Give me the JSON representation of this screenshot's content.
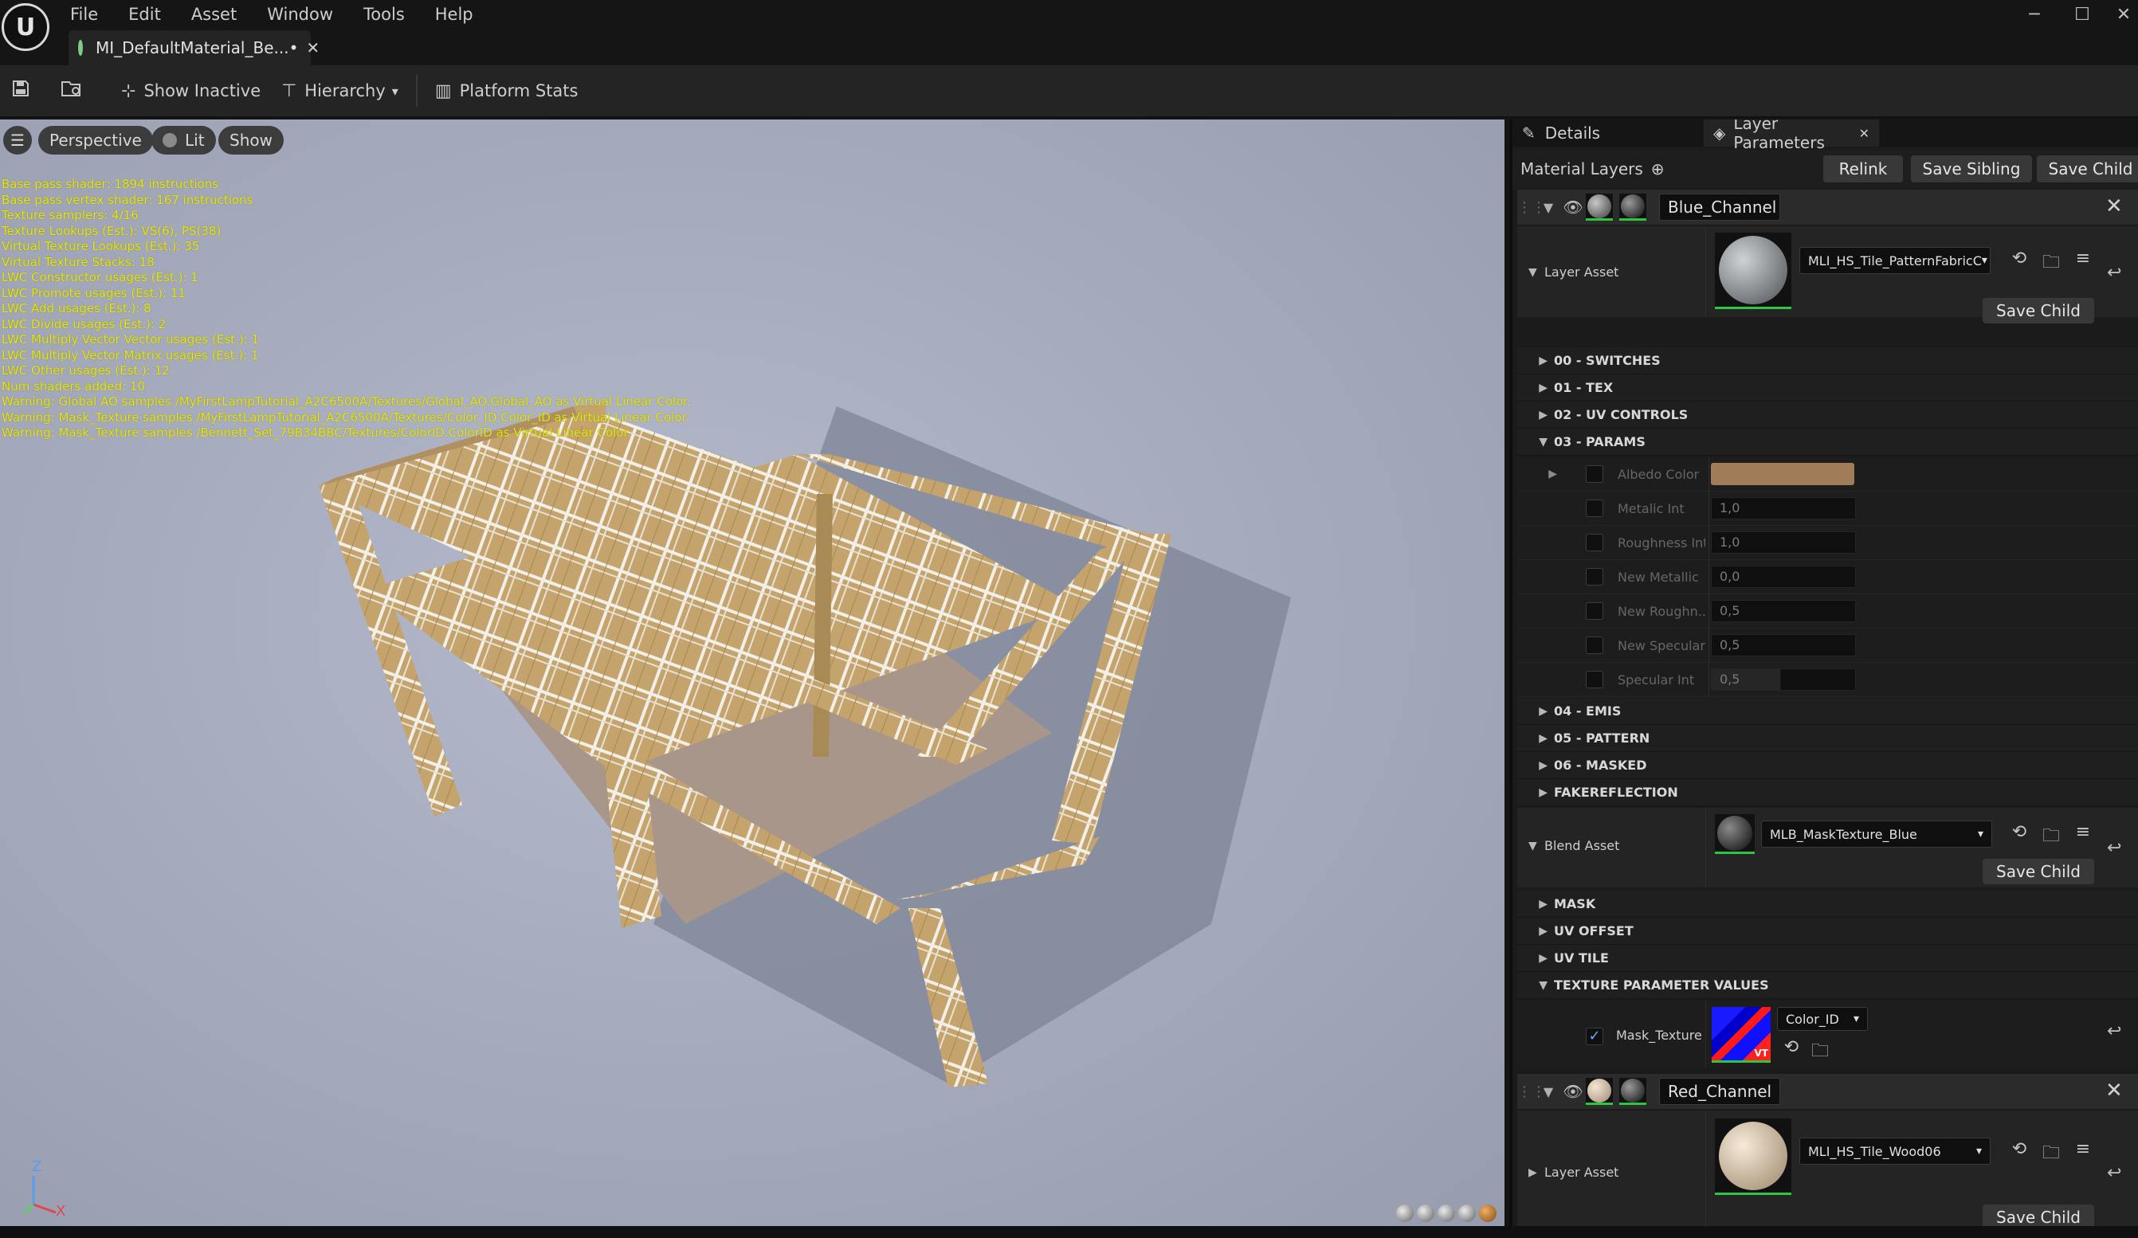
{
  "app": {
    "menu": [
      "File",
      "Edit",
      "Asset",
      "Window",
      "Tools",
      "Help"
    ],
    "tab_title": "MI_DefaultMaterial_Be...•"
  },
  "toolbar": {
    "show_inactive": "Show Inactive",
    "hierarchy": "Hierarchy",
    "platform_stats": "Platform Stats"
  },
  "viewport": {
    "perspective": "Perspective",
    "lit": "Lit",
    "show": "Show",
    "stats": [
      "Base pass shader: 1894 instructions",
      "Base pass vertex shader: 167 instructions",
      "Texture samplers: 4/16",
      "Texture Lookups (Est.): VS(6), PS(38)",
      "Virtual Texture Lookups (Est.): 35",
      "Virtual Texture Stacks: 18",
      "LWC Constructor usages (Est.): 1",
      "LWC Promote usages (Est.): 11",
      "LWC Add usages (Est.): 8",
      "LWC Divide usages (Est.): 2",
      "LWC Multiply Vector Vector usages (Est.): 1",
      "LWC Multiply Vector Matrix usages (Est.): 1",
      "LWC Other usages (Est.): 12",
      "Num shaders added: 10",
      "Warning: Global AO samples /MyFirstLampTutorial_A2C6500A/Textures/Global_AO.Global_AO as Virtual Linear Color.",
      "Warning: Mask_Texture samples /MyFirstLampTutorial_A2C6500A/Textures/Color_ID.Color_ID as Virtual Linear Color.",
      "Warning: Mask_Texture samples /Bennett_Set_79B34BBC/Textures/ColorID.ColorID as Virtual Linear Color."
    ],
    "axis_z": "Z",
    "axis_x": "X"
  },
  "panel": {
    "tab_details": "Details",
    "tab_layer_params": "Layer Parameters",
    "material_layers": "Material Layers",
    "relink": "Relink",
    "save_sibling": "Save Sibling",
    "save_child": "Save Child",
    "layer1": {
      "name": "Blue_Channel",
      "layer_asset_label": "Layer Asset",
      "layer_asset_value": "MLI_HS_Tile_PatternFabricC",
      "save_child": "Save Child",
      "sections": [
        "00 - SWITCHES",
        "01 - TEX",
        "02 - UV CONTROLS",
        "03 - PARAMS"
      ],
      "params": [
        {
          "name": "Albedo Color",
          "value": ""
        },
        {
          "name": "Metalic Int",
          "value": "1,0"
        },
        {
          "name": "Roughness Int",
          "value": "1,0"
        },
        {
          "name": "New Metallic",
          "value": "0,0"
        },
        {
          "name": "New Roughn...",
          "value": "0,5"
        },
        {
          "name": "New Specular",
          "value": "0,5"
        },
        {
          "name": "Specular Int",
          "value": "0,5"
        }
      ],
      "sections2": [
        "04 - EMIS",
        "05 - PATTERN",
        "06 - MASKED",
        "FAKEREFLECTION"
      ],
      "blend_asset_label": "Blend Asset",
      "blend_asset_value": "MLB_MaskTexture_Blue",
      "blend_save_child": "Save Child",
      "blend_sections": [
        "MASK",
        "UV OFFSET",
        "UV TILE",
        "TEXTURE PARAMETER VALUES"
      ],
      "mask_texture_label": "Mask_Texture",
      "mask_texture_value": "Color_ID",
      "vt_badge": "VT"
    },
    "layer2": {
      "name": "Red_Channel",
      "layer_asset_label": "Layer Asset",
      "layer_asset_value": "MLI_HS_Tile_Wood06",
      "save_child": "Save Child"
    }
  },
  "colors": {
    "accent_green": "#2bc83f",
    "stats_yellow": "#e5e51a",
    "albedo": "#a07d58"
  }
}
